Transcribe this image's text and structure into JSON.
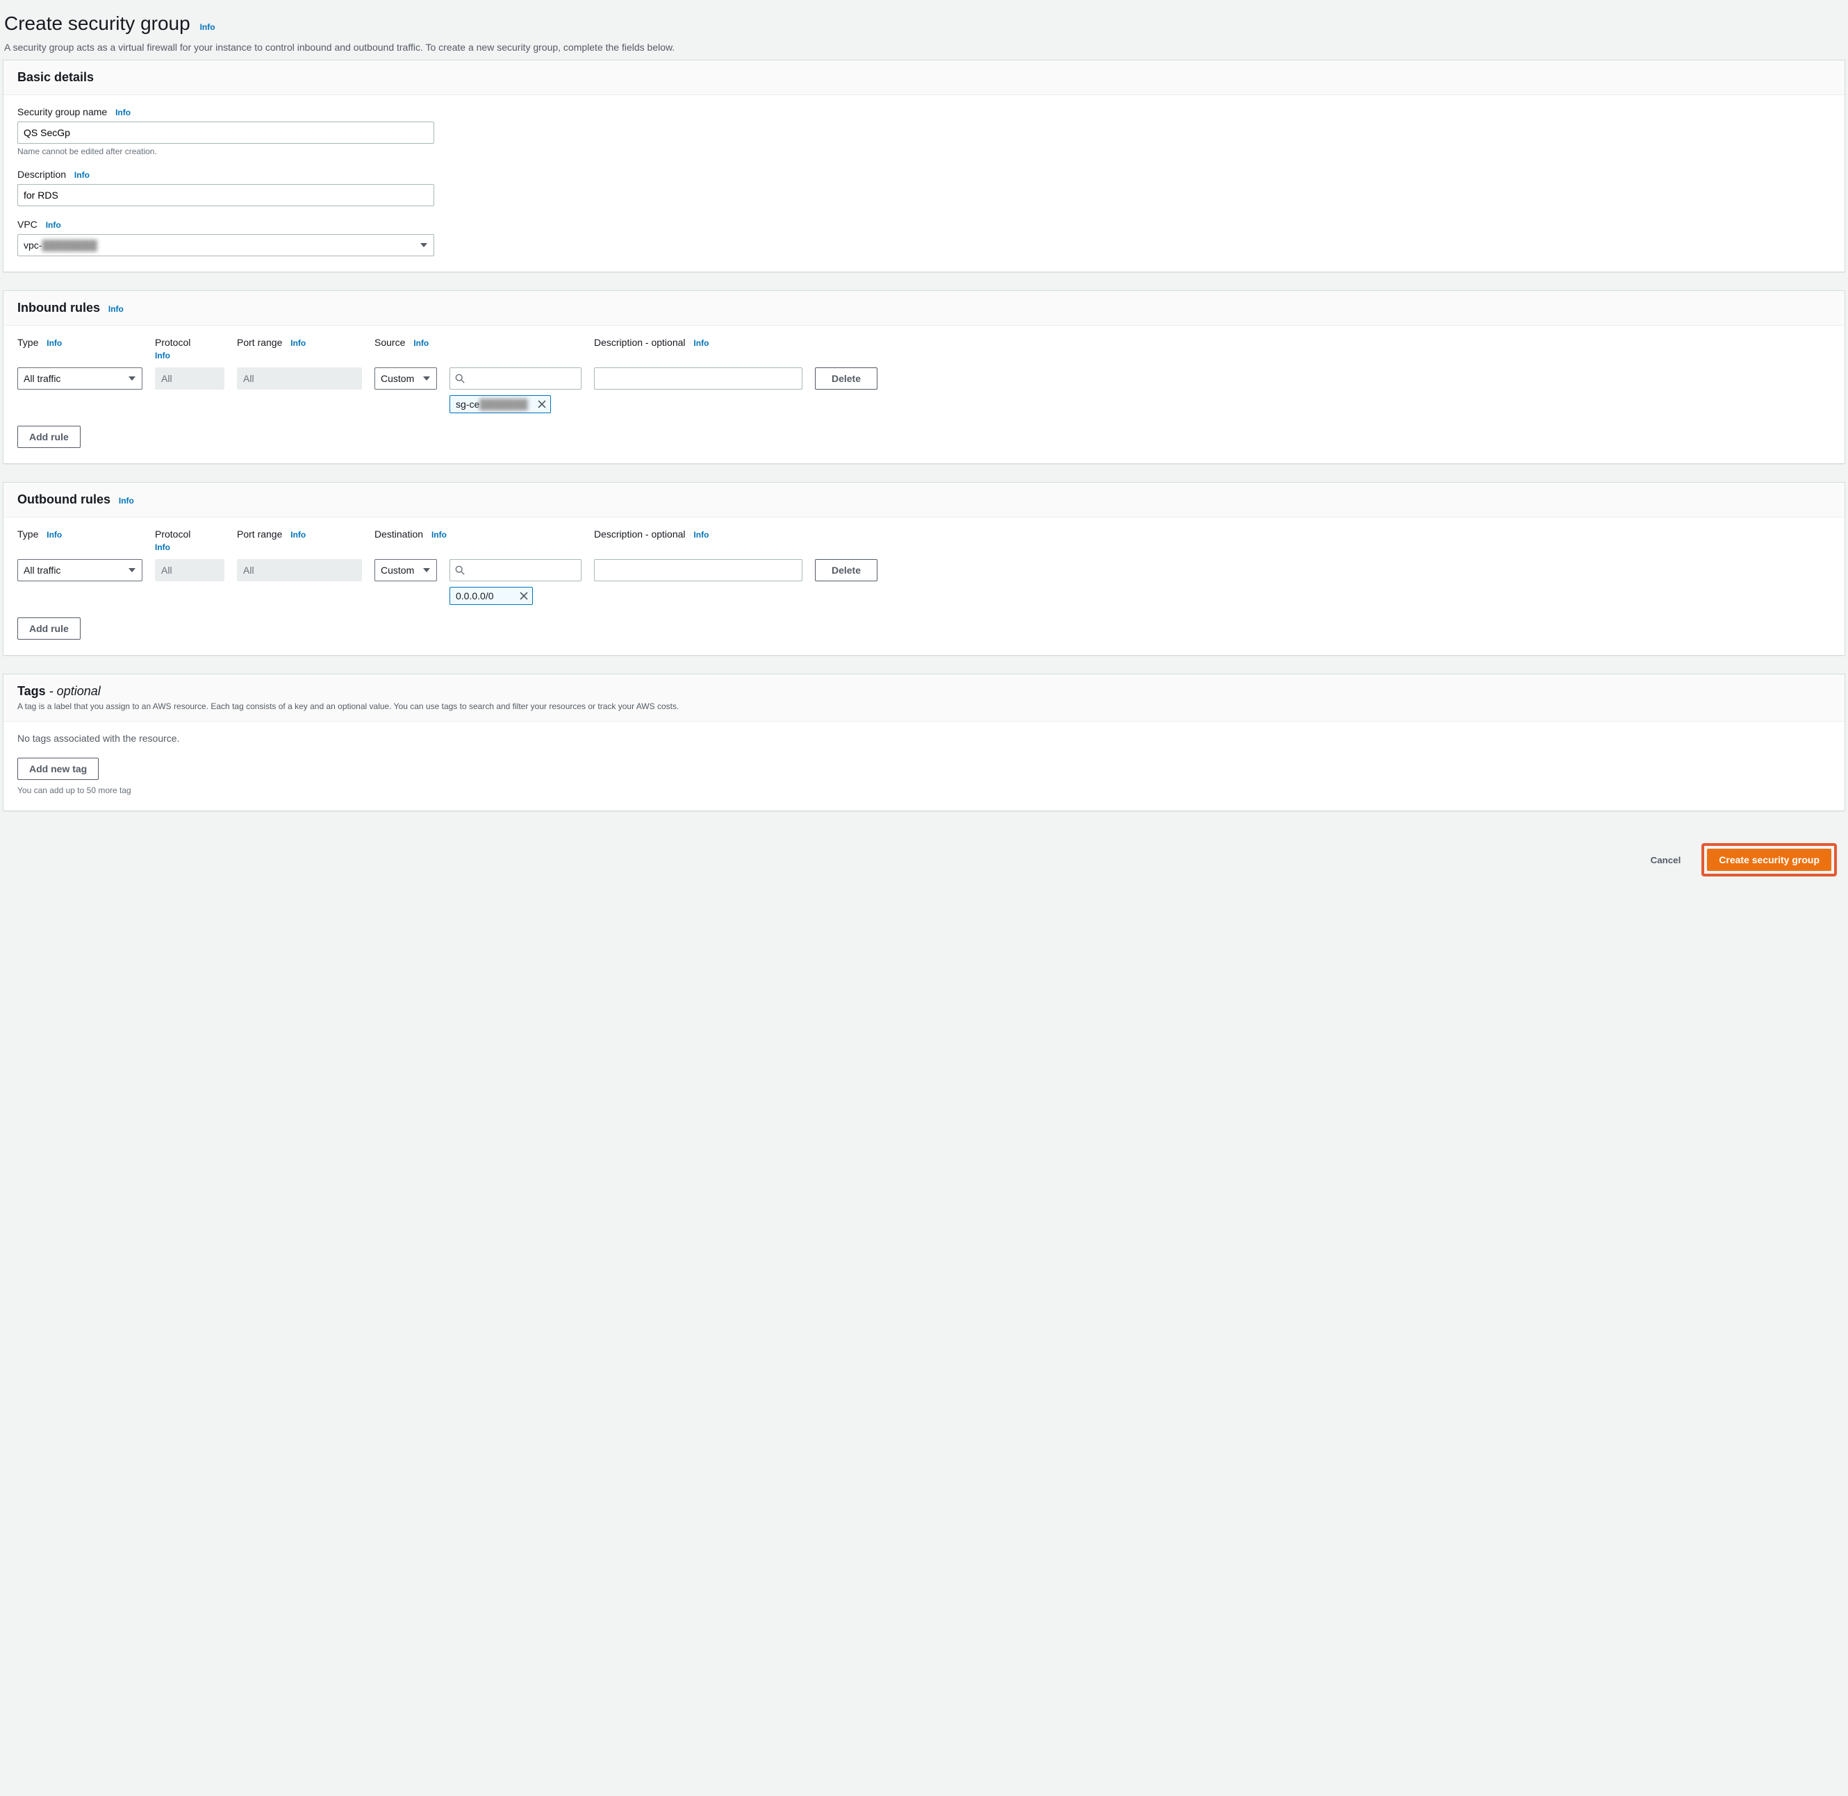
{
  "common": {
    "info": "Info"
  },
  "header": {
    "title": "Create security group",
    "subtitle": "A security group acts as a virtual firewall for your instance to control inbound and outbound traffic. To create a new security group, complete the fields below."
  },
  "basic": {
    "panel_title": "Basic details",
    "name_label": "Security group name",
    "name_value": "QS SecGp",
    "name_helper": "Name cannot be edited after creation.",
    "desc_label": "Description",
    "desc_value": "for RDS",
    "vpc_label": "VPC",
    "vpc_value_prefix": "vpc-",
    "vpc_value_obscured": "████████"
  },
  "inbound": {
    "panel_title": "Inbound rules",
    "cols": {
      "type": "Type",
      "protocol": "Protocol",
      "port": "Port range",
      "source": "Source",
      "desc": "Description - optional"
    },
    "row": {
      "type": "All traffic",
      "protocol": "All",
      "port": "All",
      "source_mode": "Custom",
      "desc": ""
    },
    "chip_prefix": "sg-ce",
    "chip_obscured": "███████",
    "add_rule": "Add rule",
    "delete": "Delete"
  },
  "outbound": {
    "panel_title": "Outbound rules",
    "cols": {
      "type": "Type",
      "protocol": "Protocol",
      "port": "Port range",
      "dest": "Destination",
      "desc": "Description - optional"
    },
    "row": {
      "type": "All traffic",
      "protocol": "All",
      "port": "All",
      "dest_mode": "Custom",
      "desc": ""
    },
    "chip": "0.0.0.0/0",
    "add_rule": "Add rule",
    "delete": "Delete"
  },
  "tags": {
    "panel_title_main": "Tags",
    "panel_title_suffix": " - optional",
    "panel_desc": "A tag is a label that you assign to an AWS resource. Each tag consists of a key and an optional value. You can use tags to search and filter your resources or track your AWS costs.",
    "empty": "No tags associated with the resource.",
    "add_tag": "Add new tag",
    "limit": "You can add up to 50 more tag"
  },
  "actions": {
    "cancel": "Cancel",
    "create": "Create security group"
  }
}
